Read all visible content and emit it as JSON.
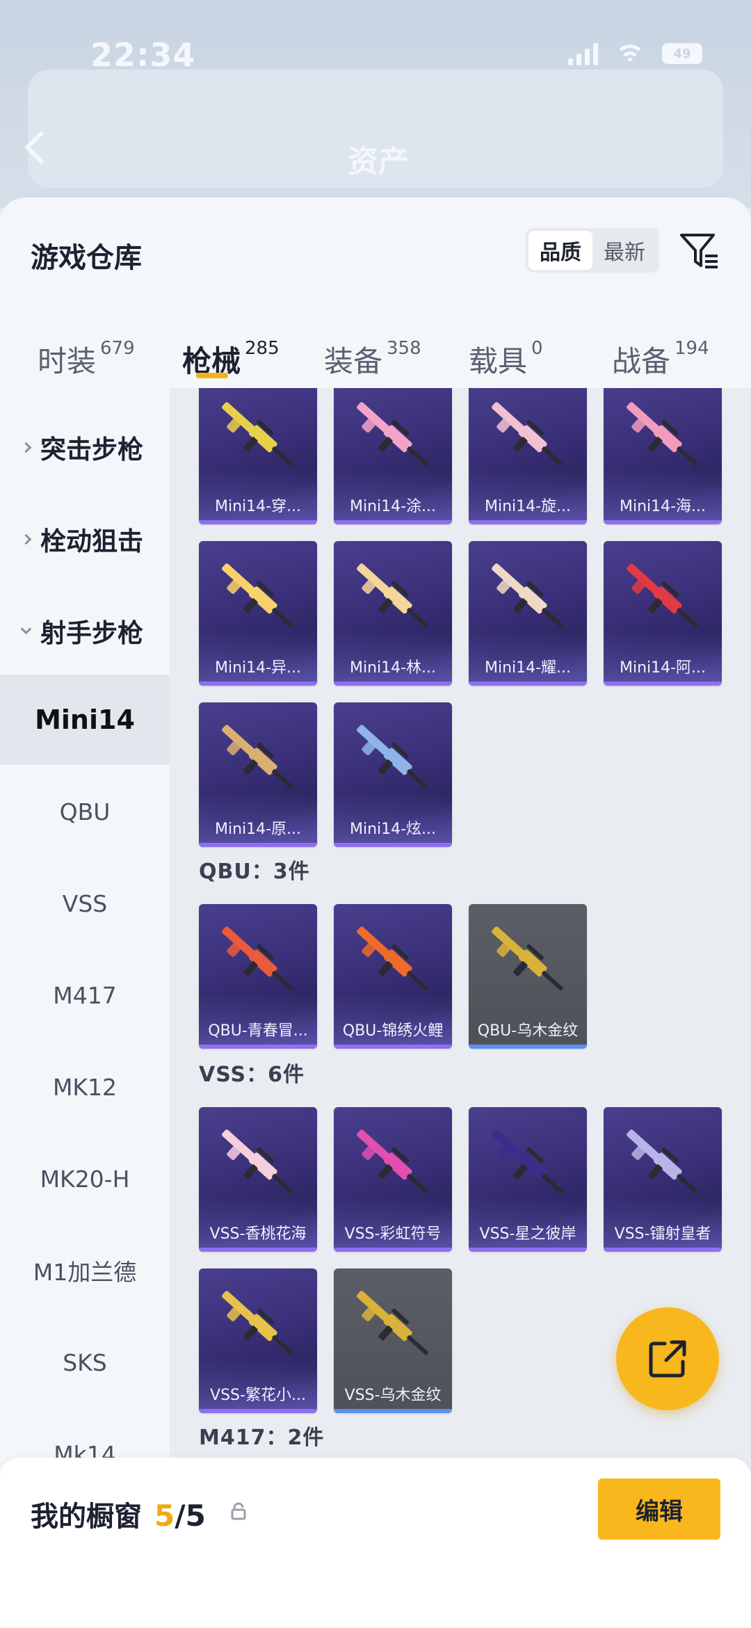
{
  "status": {
    "time": "22:34",
    "battery": "49"
  },
  "header": {
    "title": "资产"
  },
  "warehouse": {
    "title": "游戏仓库",
    "sort_options": [
      "品质",
      "最新"
    ]
  },
  "categories": [
    {
      "label": "时装",
      "count": "679"
    },
    {
      "label": "枪械",
      "count": "285"
    },
    {
      "label": "装备",
      "count": "358"
    },
    {
      "label": "载具",
      "count": "0"
    },
    {
      "label": "战备",
      "count": "194"
    }
  ],
  "sidebar": {
    "groups": [
      "突击步枪",
      "栓动狙击",
      "射手步枪"
    ],
    "items": [
      "Mini14",
      "QBU",
      "VSS",
      "M417",
      "MK12",
      "MK20-H",
      "M1加兰德",
      "SKS",
      "Mk14"
    ]
  },
  "sections": {
    "mini14": [
      {
        "name": "Mini14-穿...",
        "color": "#e9d04a"
      },
      {
        "name": "Mini14-涂...",
        "color": "#f3a3c9"
      },
      {
        "name": "Mini14-旋...",
        "color": "#f2c0d3"
      },
      {
        "name": "Mini14-海...",
        "color": "#f29bbd"
      },
      {
        "name": "Mini14-异...",
        "color": "#f7d26b"
      },
      {
        "name": "Mini14-林...",
        "color": "#f5d59a"
      },
      {
        "name": "Mini14-耀...",
        "color": "#f0d9c4"
      },
      {
        "name": "Mini14-阿...",
        "color": "#e23a44"
      },
      {
        "name": "Mini14-原...",
        "color": "#d9b072"
      },
      {
        "name": "Mini14-炫...",
        "color": "#8fb4e8"
      }
    ],
    "qbu_label": "QBU：3件",
    "qbu": [
      {
        "name": "QBU-青春冒...",
        "color": "#ea5a3c"
      },
      {
        "name": "QBU-锦绣火鲤",
        "color": "#ee6b2c"
      },
      {
        "name": "QBU-乌木金纹",
        "color": "#d9b23a"
      }
    ],
    "vss_label": "VSS：6件",
    "vss": [
      {
        "name": "VSS-香桃花海",
        "color": "#f4d0dc"
      },
      {
        "name": "VSS-彩虹符号",
        "color": "#e34fb0"
      },
      {
        "name": "VSS-星之彼岸",
        "color": "#3a2e8a"
      },
      {
        "name": "VSS-镭射皇者",
        "color": "#b8b3e8"
      },
      {
        "name": "VSS-繁花小...",
        "color": "#e7c24a"
      },
      {
        "name": "VSS-乌木金纹",
        "color": "#d9b23a"
      }
    ],
    "m417_label": "M417：2件"
  },
  "showcase": {
    "title": "我的橱窗",
    "current": "5",
    "total": "/5",
    "edit_label": "编辑"
  }
}
